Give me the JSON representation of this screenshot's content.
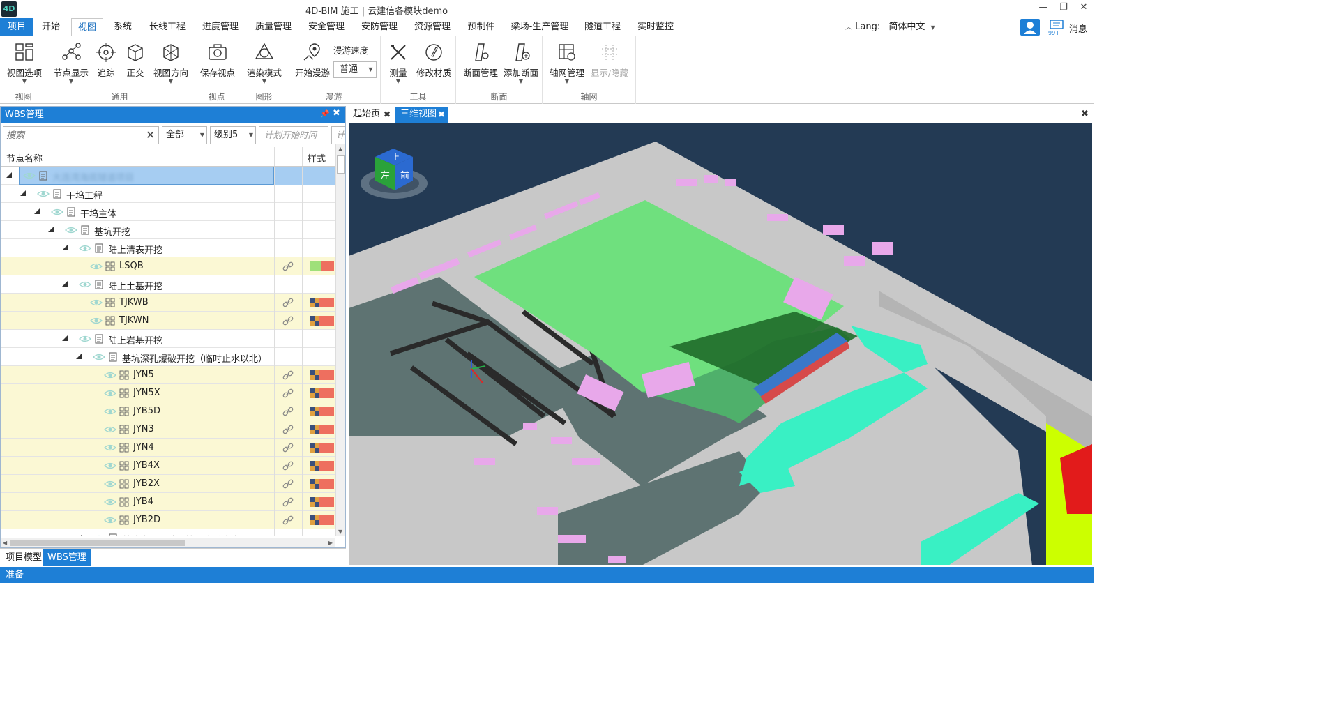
{
  "window": {
    "logo": "4D",
    "title": "4D-BIM 施工 | 云建信各模块demo",
    "minimize": "—",
    "restore": "❐",
    "close": "✕"
  },
  "menu": {
    "items": [
      "项目",
      "开始",
      "视图",
      "系统",
      "长线工程",
      "进度管理",
      "质量管理",
      "安全管理",
      "安防管理",
      "资源管理",
      "预制件",
      "梁场-生产管理",
      "隧道工程",
      "实时监控"
    ],
    "active": "视图",
    "lang_label": "Lang:",
    "lang_value": "简体中文",
    "message_label": "消息",
    "message_count": "99+"
  },
  "ribbon": {
    "groups": [
      {
        "label": "视图"
      },
      {
        "label": "通用"
      },
      {
        "label": "视点"
      },
      {
        "label": "图形"
      },
      {
        "label": "漫游"
      },
      {
        "label": "工具"
      },
      {
        "label": "断面"
      },
      {
        "label": "轴网"
      }
    ],
    "buttons": {
      "view_options": "视图选项",
      "node_display": "节点显示",
      "track": "追踪",
      "ortho": "正交",
      "view_direction": "视图方向",
      "save_viewpoint": "保存视点",
      "render_mode": "渲染模式",
      "start_roam": "开始漫游",
      "roam_speed_label": "漫游速度",
      "roam_speed_value": "普通",
      "measure": "测量",
      "modify_material": "修改材质",
      "section_manage": "断面管理",
      "add_section": "添加断面",
      "axis_manage": "轴网管理",
      "show_hide": "显示/隐藏"
    }
  },
  "wbs": {
    "title": "WBS管理",
    "search_placeholder": "搜索",
    "filter_all": "全部",
    "filter_level": "级别5",
    "date_placeholder": "计划开始时间",
    "date_placeholder2": "计",
    "col_name": "节点名称",
    "col_style": "样式",
    "rows": [
      {
        "label": "大连湾海底隧道项目",
        "level": 0,
        "type": "doc",
        "expanded": true,
        "selected": true,
        "blurred": true
      },
      {
        "label": "干坞工程",
        "level": 1,
        "type": "doc",
        "expanded": true
      },
      {
        "label": "干坞主体",
        "level": 2,
        "type": "doc",
        "expanded": true
      },
      {
        "label": "基坑开挖",
        "level": 3,
        "type": "doc",
        "expanded": true
      },
      {
        "label": "陆上清表开挖",
        "level": 4,
        "type": "doc",
        "expanded": true
      },
      {
        "label": "LSQB",
        "level": 5,
        "type": "model",
        "highlight": true,
        "swatch": [
          "#9fe07a",
          "#ee6f5f"
        ]
      },
      {
        "label": "陆上土基开挖",
        "level": 4,
        "type": "doc",
        "expanded": true
      },
      {
        "label": "TJKWB",
        "level": 5,
        "type": "model",
        "highlight": true,
        "swatch": [
          "#ee6f5f",
          "#3b4f7a",
          "#e0a040"
        ]
      },
      {
        "label": "TJKWN",
        "level": 5,
        "type": "model",
        "highlight": true,
        "swatch": [
          "#ee6f5f",
          "#3b4f7a",
          "#e0a040"
        ]
      },
      {
        "label": "陆上岩基开挖",
        "level": 4,
        "type": "doc",
        "expanded": true
      },
      {
        "label": "基坑深孔爆破开挖（临时止水以北）",
        "level": 5,
        "type": "doc",
        "expanded": true
      },
      {
        "label": "JYN5",
        "level": 6,
        "type": "model",
        "highlight": true,
        "swatch": [
          "#ee6f5f",
          "#3b4f7a",
          "#e0a040"
        ]
      },
      {
        "label": "JYN5X",
        "level": 6,
        "type": "model",
        "highlight": true,
        "swatch": [
          "#ee6f5f",
          "#3b4f7a",
          "#e0a040"
        ]
      },
      {
        "label": "JYB5D",
        "level": 6,
        "type": "model",
        "highlight": true,
        "swatch": [
          "#ee6f5f",
          "#3b4f7a",
          "#e0a040"
        ]
      },
      {
        "label": "JYN3",
        "level": 6,
        "type": "model",
        "highlight": true,
        "swatch": [
          "#ee6f5f",
          "#3b4f7a",
          "#e0a040"
        ]
      },
      {
        "label": "JYN4",
        "level": 6,
        "type": "model",
        "highlight": true,
        "swatch": [
          "#ee6f5f",
          "#3b4f7a",
          "#e0a040"
        ]
      },
      {
        "label": "JYB4X",
        "level": 6,
        "type": "model",
        "highlight": true,
        "swatch": [
          "#ee6f5f",
          "#3b4f7a",
          "#e0a040"
        ]
      },
      {
        "label": "JYB2X",
        "level": 6,
        "type": "model",
        "highlight": true,
        "swatch": [
          "#ee6f5f",
          "#3b4f7a",
          "#e0a040"
        ]
      },
      {
        "label": "JYB4",
        "level": 6,
        "type": "model",
        "highlight": true,
        "swatch": [
          "#ee6f5f",
          "#3b4f7a",
          "#e0a040"
        ]
      },
      {
        "label": "JYB2D",
        "level": 6,
        "type": "model",
        "highlight": true,
        "swatch": [
          "#ee6f5f",
          "#3b4f7a",
          "#e0a040"
        ]
      },
      {
        "label": "基坑水孔爆破开挖（临时止水以北）",
        "level": 5,
        "type": "doc",
        "expanded": true,
        "cut": true
      }
    ]
  },
  "bottom_tabs": [
    "项目模型",
    "WBS管理"
  ],
  "bottom_active": "WBS管理",
  "doc_tabs": [
    "起始页",
    "三维视图"
  ],
  "doc_active": "三维视图",
  "viewcube": {
    "top": "上",
    "left": "左",
    "front": "前"
  },
  "status": "准备",
  "colors": {
    "accent": "#1e7fd6",
    "viewport_bg": "#233a54",
    "terrain_green": "#6fe07e",
    "building_pink": "#e8a8ea",
    "highlight_row": "#fbf8d4",
    "selected_row": "#a6cdf2"
  }
}
